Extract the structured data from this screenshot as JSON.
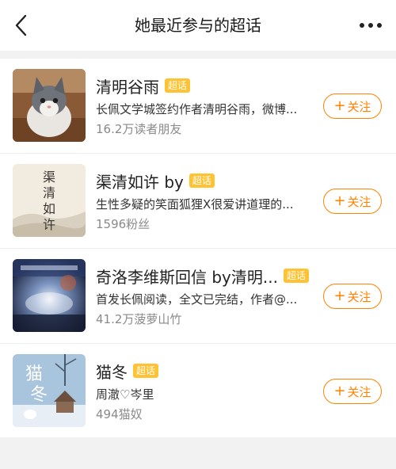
{
  "header": {
    "title": "她最近参与的超话"
  },
  "topics": [
    {
      "name": "清明谷雨",
      "badge": "超话",
      "desc": "长佩文学城签约作者清明谷雨，微博...",
      "meta": "16.2万读者朋友",
      "follow_label": "关注",
      "plus": "+"
    },
    {
      "name": "渠清如许 by",
      "badge": "超话",
      "desc": "生性多疑的笑面狐狸X很爱讲道理的...",
      "meta": "1596粉丝",
      "follow_label": "关注",
      "plus": "+",
      "cover_text": [
        "渠",
        "清",
        "如",
        "许"
      ]
    },
    {
      "name": "奇洛李维斯回信 by清明...",
      "badge": "超话",
      "desc": "首发长佩阅读，全文已完结，作者@...",
      "meta": "41.2万菠萝山竹",
      "follow_label": "关注",
      "plus": "+"
    },
    {
      "name": "猫冬",
      "badge": "超话",
      "desc": "周澈♡岑里",
      "meta": "494猫奴",
      "follow_label": "关注",
      "plus": "+",
      "cover_text": [
        "猫",
        "冬"
      ]
    }
  ]
}
